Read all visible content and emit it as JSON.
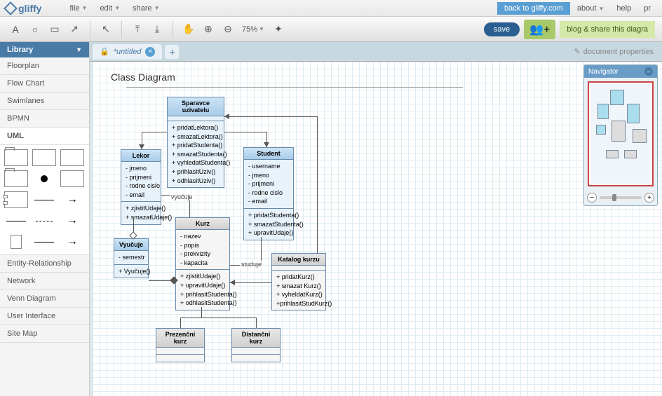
{
  "app": {
    "name": "gliffy"
  },
  "topmenu": {
    "file": "file",
    "edit": "edit",
    "share": "share"
  },
  "topright": {
    "back": "back to gliffy.com",
    "about": "about",
    "help": "help",
    "pr": "pr"
  },
  "toolbar": {
    "zoom": "75%",
    "save": "save",
    "blog": "blog & share this diagra"
  },
  "sidebar": {
    "header": "Library",
    "items": [
      "Floorplan",
      "Flow Chart",
      "Swimlanes",
      "BPMN",
      "UML",
      "Entity-Relationship",
      "Network",
      "Venn Diagram",
      "User Interface",
      "Site Map"
    ]
  },
  "tabs": {
    "current": "*untitled",
    "docprops": "document properties"
  },
  "diagram": {
    "title": "Class Diagram",
    "spravce": {
      "name": "Sparavce uzivatelu",
      "ops": [
        "+ pridatLektora()",
        "+ smazatLektora()",
        "+ pridatStudenta()",
        "+ smazatStudenta()",
        "+ vyhledatStudenta()",
        "+ prihlasitUziv()",
        "+ odhlasitUziv()"
      ]
    },
    "lektor": {
      "name": "Lekor",
      "attrs": [
        "- jmeno",
        "- prijmeni",
        "- rodne cislo",
        "- email"
      ],
      "ops": [
        "+ zjistitUdaje()",
        "+ smazatUdaje()"
      ]
    },
    "student": {
      "name": "Student",
      "attrs": [
        "- username",
        "- jmeno",
        "- prijmeni",
        "- rodne cislo",
        "- email"
      ],
      "ops": [
        "+ pridatStudenta()",
        "+ smazatStudenta()",
        "+ upravitUdaje()"
      ]
    },
    "vyucuje": {
      "name": "Vyučuje",
      "attrs": [
        "- semestr"
      ],
      "ops": [
        "+ Vyučuje()"
      ]
    },
    "kurz": {
      "name": "Kurz",
      "attrs": [
        "- nazev",
        "- popis",
        "- prekvizity",
        "- kapacita"
      ],
      "ops": [
        "+ zjistitUdaje()",
        "+ upravitUdaje()",
        "+ prihlasitStudenta()",
        "+ odhlasitStudenta()"
      ]
    },
    "katalog": {
      "name": "Katalog kurzu",
      "ops": [
        "+ pridatKurz()",
        "+ smazat Kurz()",
        "+ vyheldatKurz()",
        "+prihlasitStudKurz()"
      ]
    },
    "prezencni": {
      "name": "Prezenční kurz"
    },
    "distancni": {
      "name": "Distanční kurz"
    },
    "labels": {
      "vyucuje": "vyučuje",
      "studuje": "studuje"
    }
  },
  "navigator": {
    "title": "Navigator"
  }
}
